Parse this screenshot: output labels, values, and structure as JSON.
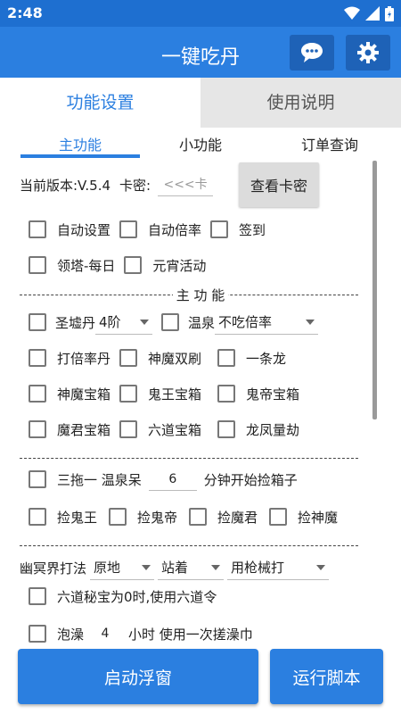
{
  "status": {
    "time": "2:48"
  },
  "app": {
    "title": "一键吃丹"
  },
  "tabs": [
    {
      "label": "功能设置"
    },
    {
      "label": "使用说明"
    }
  ],
  "subtabs": [
    {
      "label": "主功能"
    },
    {
      "label": "小功能"
    },
    {
      "label": "订单查询"
    }
  ],
  "version": {
    "label": "当前版本:V.5.4",
    "key_label": "卡密:",
    "key_placeholder": "<<<卡",
    "view_button": "查看卡密"
  },
  "options_row1": [
    {
      "label": "自动设置"
    },
    {
      "label": "自动倍率"
    },
    {
      "label": "签到"
    }
  ],
  "options_row2": [
    {
      "label": "领塔-每日"
    },
    {
      "label": "元宵活动"
    }
  ],
  "section_title": "主 功 能",
  "shengxu": {
    "label": "圣墟丹",
    "select": "4阶",
    "wenquan_label": "温泉",
    "wenquan_select": "不吃倍率"
  },
  "row_a": [
    {
      "label": "打倍率丹"
    },
    {
      "label": "神魔双刷"
    },
    {
      "label": "一条龙"
    }
  ],
  "row_b": [
    {
      "label": "神魔宝箱"
    },
    {
      "label": "鬼王宝箱"
    },
    {
      "label": "鬼帝宝箱"
    }
  ],
  "row_c": [
    {
      "label": "魔君宝箱"
    },
    {
      "label": "六道宝箱"
    },
    {
      "label": "龙凤量劫"
    }
  ],
  "santuo": {
    "label": "三拖一 温泉呆",
    "minutes": "6",
    "suffix": "分钟开始捡箱子"
  },
  "pick": [
    {
      "label": "捡鬼王"
    },
    {
      "label": "捡鬼帝"
    },
    {
      "label": "捡魔君"
    },
    {
      "label": "捡神魔"
    }
  ],
  "youming": {
    "label": "幽冥界打法",
    "select1": "原地",
    "select2": "站着",
    "select3": "用枪械打"
  },
  "liudao": {
    "label": "六道秘宝为0时,使用六道令"
  },
  "paozao": {
    "label": "泡澡",
    "hours": "4",
    "suffix": "小时 使用一次搓澡巾"
  },
  "buttons": {
    "float": "启动浮窗",
    "run": "运行脚本"
  },
  "colors": {
    "primary": "#2b7fe0",
    "statusbar": "#1e6fd0",
    "icon_button": "#1e62b7"
  }
}
